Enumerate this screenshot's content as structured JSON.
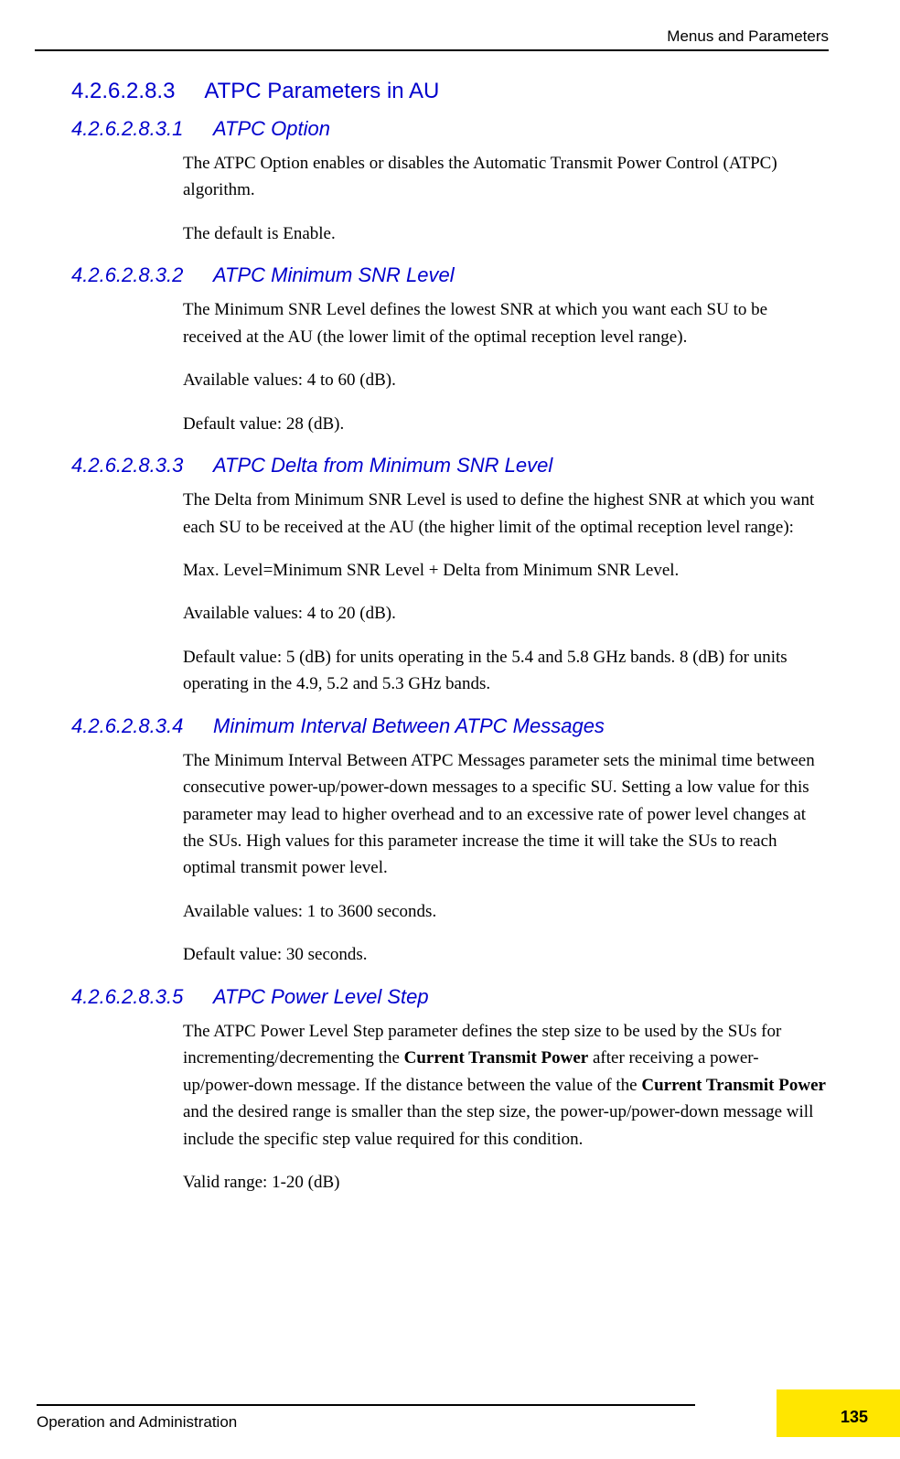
{
  "header": {
    "right": "Menus and Parameters"
  },
  "h3": {
    "num": "4.2.6.2.8.3",
    "title": "ATPC Parameters in AU"
  },
  "s1": {
    "num": "4.2.6.2.8.3.1",
    "title": "ATPC Option",
    "p1": "The ATPC Option enables or disables the Automatic Transmit Power Control (ATPC) algorithm.",
    "p2": "The default is Enable."
  },
  "s2": {
    "num": "4.2.6.2.8.3.2",
    "title": "ATPC Minimum SNR Level",
    "p1": "The Minimum SNR Level defines the lowest SNR at which you want each SU to be received at the AU (the lower limit of the optimal reception level range).",
    "p2": "Available values: 4 to 60 (dB).",
    "p3": "Default value: 28 (dB)."
  },
  "s3": {
    "num": "4.2.6.2.8.3.3",
    "title": "ATPC Delta from Minimum SNR Level",
    "p1": "The Delta from Minimum SNR Level is used to define the highest SNR at which you want each SU to be received at the AU (the higher limit of the optimal reception level range):",
    "p2": "Max. Level=Minimum SNR Level + Delta from Minimum SNR Level.",
    "p3": "Available values: 4 to 20 (dB).",
    "p4": "Default value: 5 (dB) for units operating in the 5.4 and 5.8 GHz bands. 8 (dB) for units operating in the 4.9, 5.2 and 5.3 GHz bands."
  },
  "s4": {
    "num": "4.2.6.2.8.3.4",
    "title": "Minimum Interval Between ATPC Messages",
    "p1": "The Minimum Interval Between ATPC Messages parameter sets the minimal time between consecutive power-up/power-down messages to a specific SU. Setting a low value for this parameter may lead to higher overhead and to an excessive rate of power level changes at the SUs. High values for this parameter increase the time it will take the SUs to reach optimal transmit power level.",
    "p2": "Available values: 1 to 3600 seconds.",
    "p3": "Default value: 30 seconds."
  },
  "s5": {
    "num": "4.2.6.2.8.3.5",
    "title": "ATPC Power Level Step",
    "p1a": "The ATPC Power Level Step parameter defines the step size to be used by the SUs for incrementing/decrementing the ",
    "p1b": "Current Transmit Power",
    "p1c": " after receiving a power-up/power-down message. If the distance between the value of the ",
    "p1d": "Current Transmit Power",
    "p1e": " and the desired range is smaller than the step size, the power-up/power-down message will include the specific step value required for this condition.",
    "p2": "Valid range: 1-20 (dB)"
  },
  "footer": {
    "left": "Operation and Administration",
    "page": "135"
  }
}
